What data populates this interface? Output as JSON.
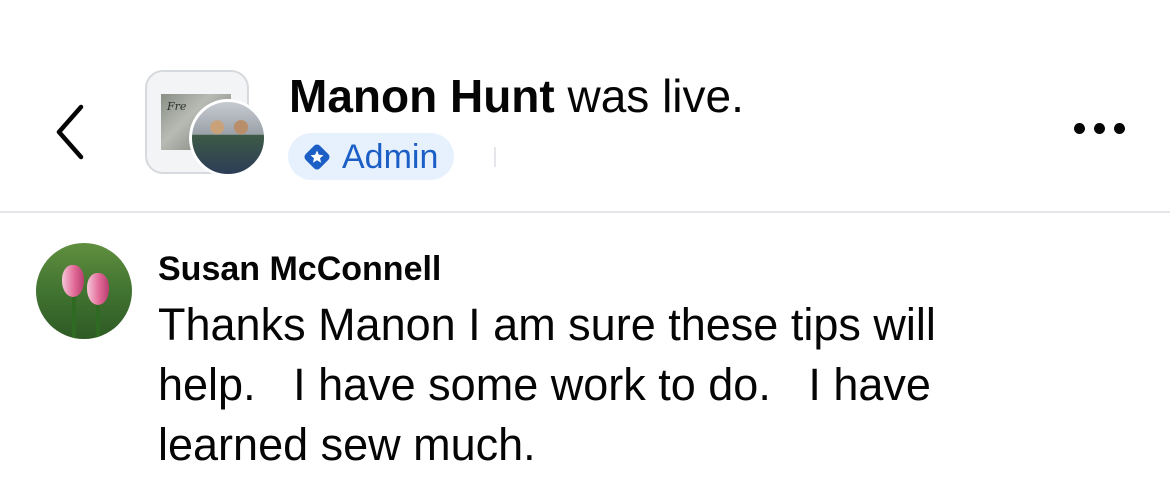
{
  "header": {
    "author_name": "Manon Hunt",
    "title_suffix": " was live.",
    "badge_label": "Admin",
    "icons": {
      "back": "chevron-left-icon",
      "badge": "admin-star-icon",
      "more": "more-options-icon"
    }
  },
  "comment": {
    "author": "Susan McConnell",
    "text": "Thanks Manon I am sure these tips will\nhelp.   I have some work to do.   I have\nlearned sew much."
  },
  "colors": {
    "badge_background": "#e7f1fd",
    "badge_text": "#1b5fc6",
    "divider": "#e4e6ea",
    "text": "#050505"
  }
}
